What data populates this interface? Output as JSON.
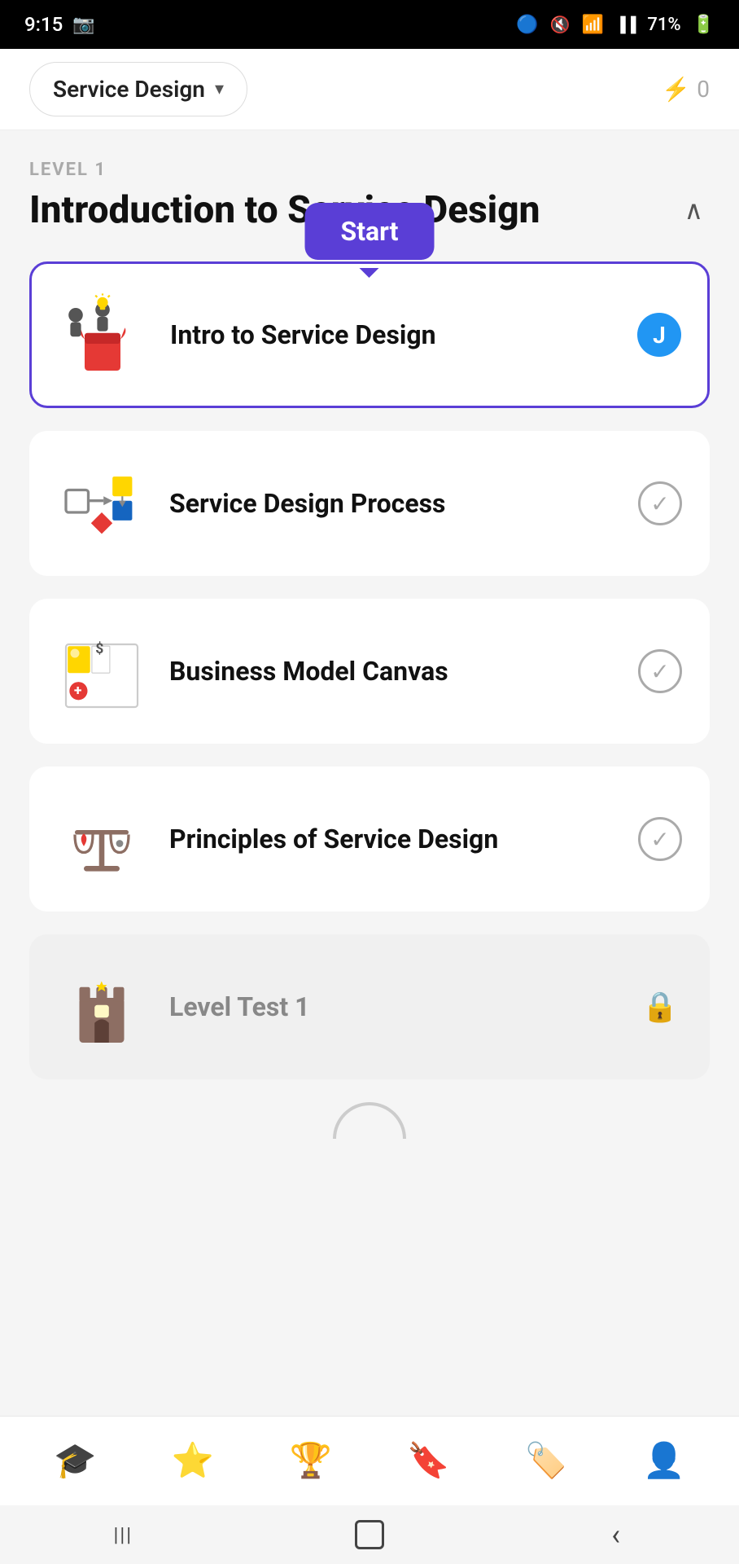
{
  "statusBar": {
    "time": "9:15",
    "bluetooth": "⚡",
    "battery": "71%",
    "signal": "📶"
  },
  "header": {
    "courseLabel": "Service Design",
    "chevron": "▾",
    "lightningLabel": "0"
  },
  "level": {
    "levelLabel": "LEVEL 1",
    "sectionTitle": "Introduction to Service Design"
  },
  "tooltip": {
    "startLabel": "Start"
  },
  "lessons": [
    {
      "id": "intro",
      "title": "Intro to Service Design",
      "status": "active",
      "statusType": "avatar",
      "avatarLetter": "J"
    },
    {
      "id": "process",
      "title": "Service Design Process",
      "status": "checked",
      "statusType": "check"
    },
    {
      "id": "canvas",
      "title": "Business Model Canvas",
      "status": "checked",
      "statusType": "check"
    },
    {
      "id": "principles",
      "title": "Principles of Service Design",
      "status": "checked",
      "statusType": "check"
    },
    {
      "id": "test",
      "title": "Level Test 1",
      "status": "locked",
      "statusType": "lock"
    }
  ],
  "bottomNav": {
    "items": [
      {
        "id": "home",
        "icon": "🎓",
        "active": true
      },
      {
        "id": "achievements",
        "icon": "⭐",
        "active": false
      },
      {
        "id": "leaderboard",
        "icon": "🏆",
        "active": false
      },
      {
        "id": "bookmarks",
        "icon": "🔖",
        "active": false
      },
      {
        "id": "tags",
        "icon": "🏷️",
        "active": false
      },
      {
        "id": "profile",
        "icon": "👤",
        "active": false
      }
    ]
  },
  "androidNav": {
    "menu": "☰",
    "home": "⬜",
    "back": "‹"
  }
}
